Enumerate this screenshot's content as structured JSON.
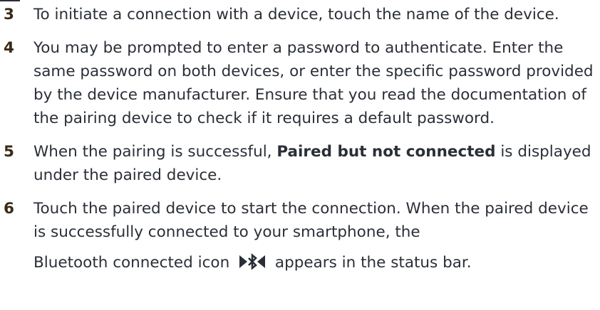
{
  "steps": [
    {
      "number": "3",
      "text": "To initiate a connection with a device, touch the name of the device."
    },
    {
      "number": "4",
      "text": "You may be prompted to enter a password to authenticate. Enter the same password on both devices, or enter the specific password provided by the device manufacturer. Ensure that you read the documentation of the pairing device to check if it requires a default password."
    },
    {
      "number": "5",
      "text_before": "When the pairing is successful, ",
      "bold": "Paired but not connected",
      "text_after": " is displayed under the paired device."
    },
    {
      "number": "6",
      "text": "Touch the paired device to start the connection. When the paired device is successfully connected to your smartphone, the",
      "line2_before": "Bluetooth connected icon",
      "icon": "bluetooth-connected-icon",
      "line2_after": "appears in the status bar."
    }
  ]
}
